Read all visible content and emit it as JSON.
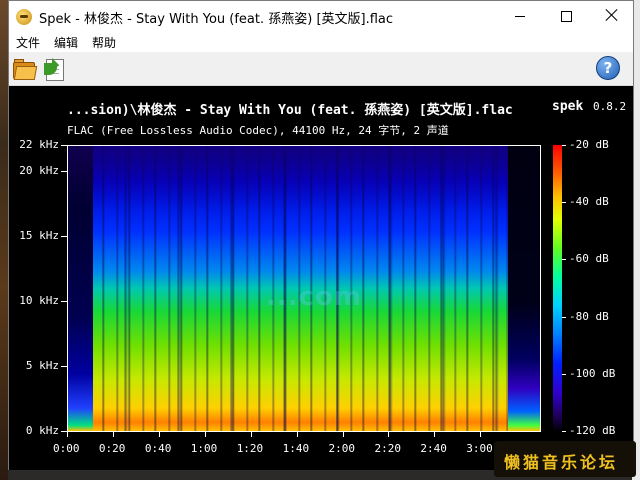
{
  "window": {
    "title": "Spek - 林俊杰 - Stay With You (feat. 孫燕姿) [英文版].flac"
  },
  "menu": {
    "file": "文件",
    "edit": "编辑",
    "help": "帮助"
  },
  "toolbar": {
    "open_icon": "folder-open-icon",
    "save_icon": "save-image-icon",
    "help_icon": "help-icon",
    "help_glyph": "?"
  },
  "spek": {
    "track_title": "...sion)\\林俊杰 -  Stay With You (feat. 孫燕姿) [英文版].flac",
    "brand": "spek",
    "version": "0.8.2",
    "track_info": "FLAC (Free Lossless Audio Codec), 44100 Hz, 24 字节, 2 声道",
    "watermark": "...com"
  },
  "chart_data": {
    "type": "heatmap",
    "title": "",
    "y_axis": {
      "ticks": [
        "22 kHz",
        "20 kHz",
        "15 kHz",
        "10 kHz",
        "5 kHz",
        "0 kHz"
      ],
      "values_khz": [
        22,
        20,
        15,
        10,
        5,
        0
      ],
      "range_khz": [
        0,
        22
      ]
    },
    "x_axis": {
      "ticks": [
        "0:00",
        "0:20",
        "0:40",
        "1:00",
        "1:20",
        "1:40",
        "2:00",
        "2:20",
        "2:40",
        "3:00"
      ],
      "values_s": [
        0,
        20,
        40,
        60,
        80,
        100,
        120,
        140,
        160,
        180
      ],
      "range_s": [
        0,
        206
      ]
    },
    "colorbar": {
      "ticks": [
        "-20 dB",
        "-40 dB",
        "-60 dB",
        "-80 dB",
        "-100 dB",
        "-120 dB"
      ],
      "values_db": [
        -20,
        -40,
        -60,
        -80,
        -100,
        -120
      ],
      "range_db": [
        -120,
        -20
      ]
    }
  },
  "overlay": {
    "forum_name": "懒猫音乐论坛"
  }
}
